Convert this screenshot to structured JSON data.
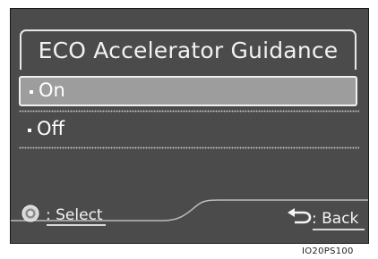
{
  "screen": {
    "title": "ECO Accelerator Guidance",
    "options": [
      {
        "label": "On",
        "selected": true
      },
      {
        "label": "Off",
        "selected": false
      }
    ]
  },
  "footer": {
    "select_label": ": Select",
    "select_icon": "dial-icon",
    "back_label": ": Back",
    "back_icon": "return-arrow-icon"
  },
  "figure_code": "IO20PS100"
}
